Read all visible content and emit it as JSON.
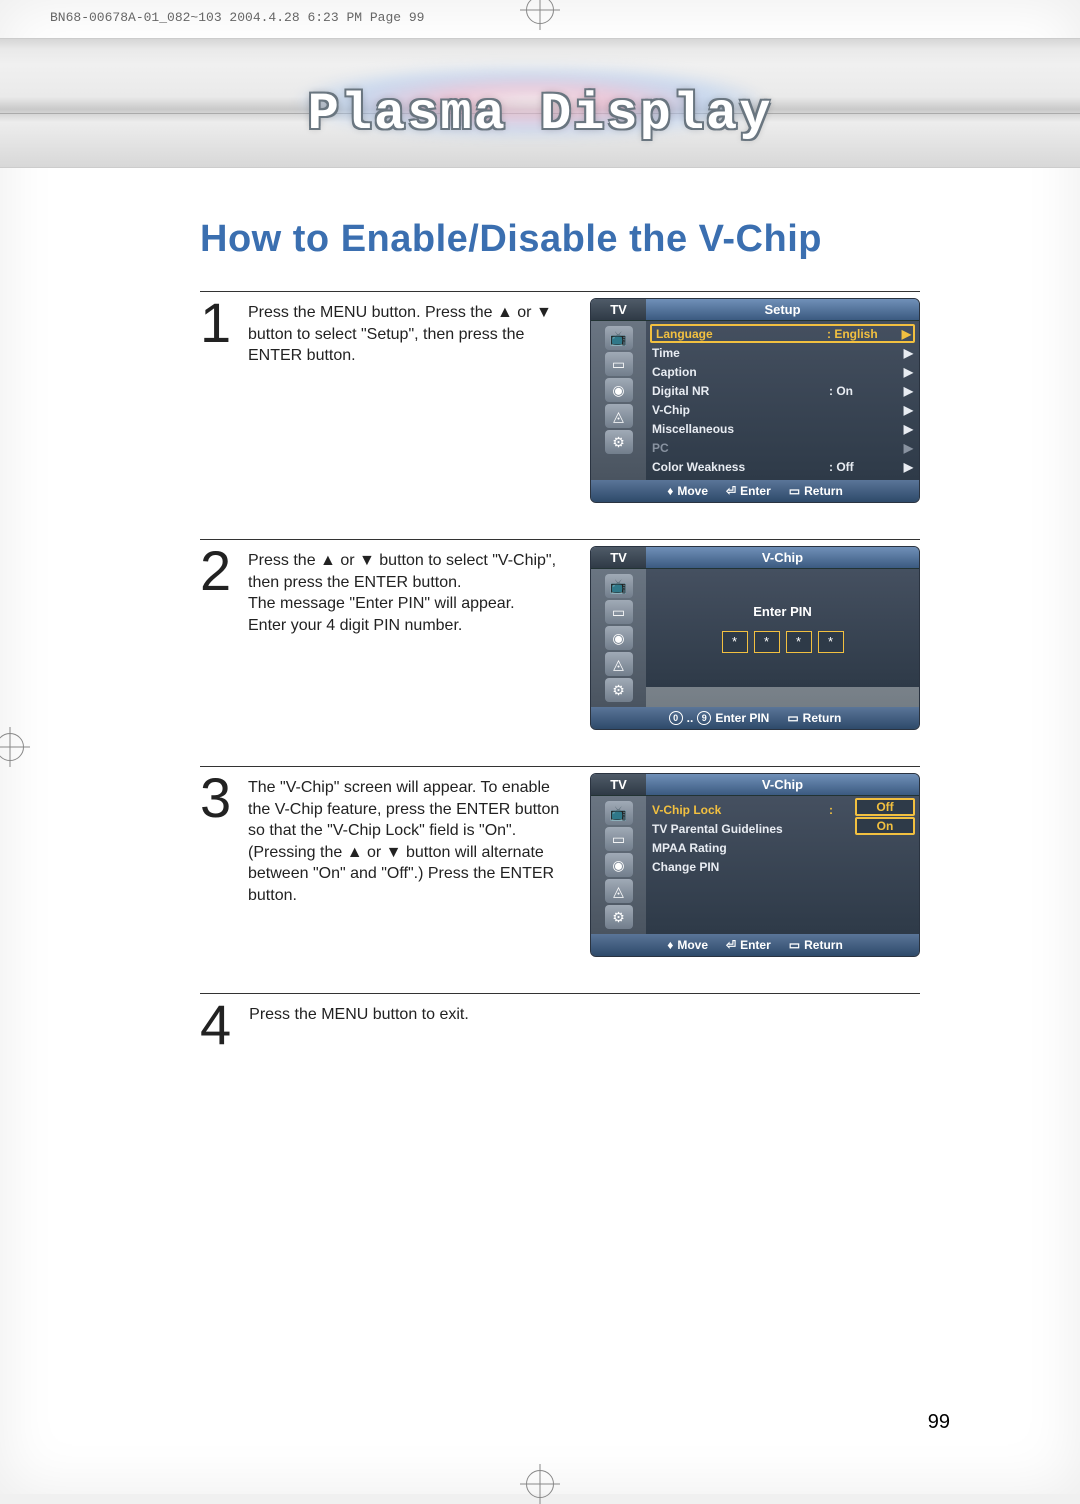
{
  "print_info": "BN68-00678A-01_082~103  2004.4.28  6:23 PM  Page 99",
  "banner_title": "Plasma Display",
  "heading": "How to Enable/Disable the V-Chip",
  "page_number": "99",
  "steps": [
    {
      "text": "Press the MENU button. Press the ▲ or ▼ button to select \"Setup\", then press the ENTER button."
    },
    {
      "text": "Press the ▲ or ▼ button to select \"V-Chip\", then press the ENTER button.\nThe message \"Enter PIN\" will appear.\nEnter your 4 digit PIN number."
    },
    {
      "text": "The \"V-Chip\" screen will appear. To enable the V-Chip feature, press the ENTER button so that the \"V-Chip Lock\" field is \"On\". (Pressing the ▲ or ▼ button will alternate between \"On\" and \"Off\".) Press the ENTER button."
    },
    {
      "text": "Press the MENU button to exit."
    }
  ],
  "osd1": {
    "tv": "TV",
    "title": "Setup",
    "rows": [
      {
        "lbl": "Language",
        "val": ":  English",
        "sel": true
      },
      {
        "lbl": "Time",
        "val": ""
      },
      {
        "lbl": "Caption",
        "val": ""
      },
      {
        "lbl": "Digital NR",
        "val": ":  On"
      },
      {
        "lbl": "V-Chip",
        "val": ""
      },
      {
        "lbl": "Miscellaneous",
        "val": ""
      },
      {
        "lbl": "PC",
        "val": "",
        "disabled": true
      },
      {
        "lbl": "Color Weakness",
        "val": ":  Off"
      }
    ],
    "footer": {
      "move": "Move",
      "enter": "Enter",
      "ret": "Return"
    }
  },
  "osd2": {
    "tv": "TV",
    "title": "V-Chip",
    "pin_label": "Enter PIN",
    "pin_char": "*",
    "footer": {
      "enterpin": "Enter PIN",
      "ret": "Return",
      "keys": "0..9"
    }
  },
  "osd3": {
    "tv": "TV",
    "title": "V-Chip",
    "rows": [
      {
        "lbl": "V-Chip Lock",
        "val": ":",
        "sel": true,
        "overlay_off": "Off"
      },
      {
        "lbl": "TV Parental Guidelines",
        "val": "",
        "overlay_on": "On"
      },
      {
        "lbl": "MPAA Rating",
        "val": ""
      },
      {
        "lbl": "Change PIN",
        "val": ""
      }
    ],
    "footer": {
      "move": "Move",
      "enter": "Enter",
      "ret": "Return"
    }
  }
}
